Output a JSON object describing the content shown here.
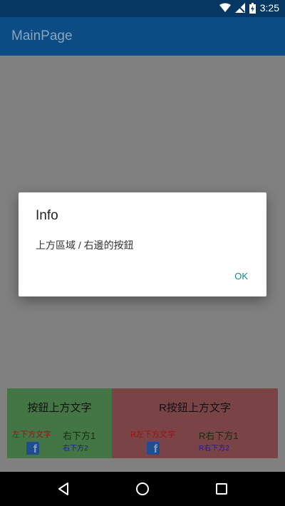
{
  "status_bar": {
    "time": "3:25",
    "icons": [
      "wifi-icon",
      "signal-icon",
      "battery-icon"
    ]
  },
  "app_bar": {
    "title": "MainPage"
  },
  "dialog": {
    "title": "Info",
    "message": "上方區域 / 右邊的按鈕",
    "ok_label": "OK"
  },
  "left_panel": {
    "title": "按鈕上方文字",
    "bottom_left_text": "左下方文字",
    "bottom_right_text_1": "右下方1",
    "bottom_right_text_2": "右下方2",
    "icon": "facebook-icon"
  },
  "right_panel": {
    "title": "R按鈕上方文字",
    "bottom_left_text": "R左下方文字",
    "bottom_right_text_1": "R右下方1",
    "bottom_right_text_2": "R右下方2",
    "icon": "facebook-icon"
  },
  "nav_bar": {
    "buttons": [
      "back-icon",
      "home-icon",
      "recents-icon"
    ]
  },
  "colors": {
    "status_bar": "#053763",
    "app_bar": "#0b4c85",
    "scrim": "#808080",
    "left_panel": "#447645",
    "right_panel": "#7a4346",
    "ok_text": "#138a8a"
  }
}
